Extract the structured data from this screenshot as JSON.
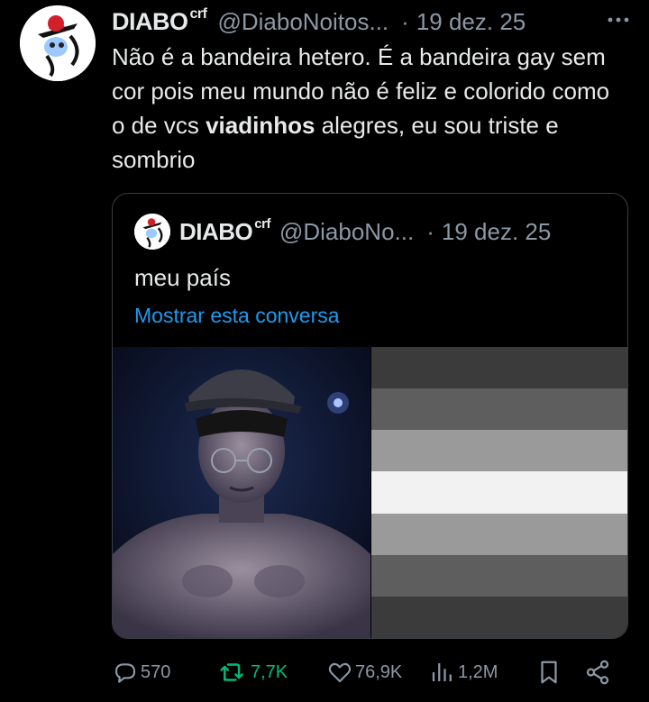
{
  "tweet": {
    "author_name": "DIABO",
    "author_suffix": "crf",
    "handle": "@DiaboNoitos...",
    "separator": "·",
    "date": "19 dez. 25",
    "text_part1": "Não é a bandeira hetero. É a bandeira gay sem cor pois meu mundo não é feliz e colorido como o de vcs ",
    "text_bold": "viadinhos",
    "text_part2": " alegres, eu sou triste e sombrio"
  },
  "quote": {
    "author_name": "DIABO",
    "author_suffix": "crf",
    "handle": "@DiaboNo...",
    "separator": "·",
    "date": "19 dez. 25",
    "text": "meu país",
    "show_thread_link": "Mostrar esta conversa",
    "flag_stripes": [
      "#3b3b3b",
      "#5e5e5e",
      "#9a9a9a",
      "#f2f2f2",
      "#9a9a9a",
      "#5e5e5e",
      "#3b3b3b"
    ]
  },
  "actions": {
    "replies": "570",
    "reposts": "7,7K",
    "likes": "76,9K",
    "views": "1,2M"
  },
  "colors": {
    "background": "#000000",
    "text": "#e7e9ea",
    "muted": "#8b98a5",
    "link": "#1d9bf0",
    "repost": "#00ba7c"
  },
  "icons": [
    "more-icon",
    "reply-icon",
    "repost-icon",
    "like-icon",
    "views-icon",
    "bookmark-icon",
    "share-icon"
  ]
}
